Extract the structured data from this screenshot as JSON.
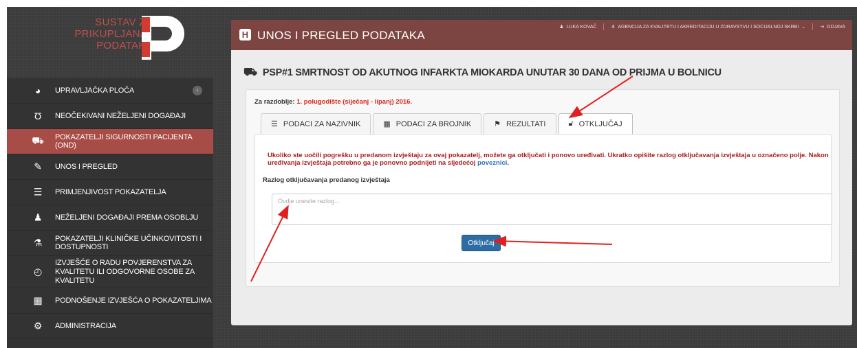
{
  "logo": {
    "line1": "SUSTAV ZA",
    "line2": "PRIKUPLJANJE",
    "line3": "PODATAKA"
  },
  "sidebar": {
    "items": [
      {
        "label": "UPRAVLJAČKA PLOČA",
        "icon": "dashboard-icon"
      },
      {
        "label": "NEOČEKIVANI NEŽELJENI DOGAĐAJI",
        "icon": "stethoscope-icon"
      },
      {
        "label": "POKAZATELJI SIGURNOSTI PACIJENTA (OND)",
        "icon": "ambulance-icon",
        "active": true
      },
      {
        "label": "UNOS I PREGLED",
        "icon": "edit-icon"
      },
      {
        "label": "PRIMJENJIVOST POKAZATELJA",
        "icon": "list-icon"
      },
      {
        "label": "NEŽELJENI DOGAĐAJI PREMA OSOBLJU",
        "icon": "user-md-icon"
      },
      {
        "label": "POKAZATELJI KLINIČKE UČINKOVITOSTI I DOSTUPNOSTI",
        "icon": "flask-icon"
      },
      {
        "label": "IZVJEŠĆE O RADU POVJERENSTVA ZA KVALITETU ILI ODGOVORNE OSOBE ZA KVALITETU",
        "icon": "clock-icon"
      },
      {
        "label": "PODNOŠENJE IZVJEŠĆA O POKAZATELJIMA",
        "icon": "table-icon"
      },
      {
        "label": "ADMINISTRACIJA",
        "icon": "gears-icon"
      }
    ]
  },
  "header": {
    "title": "UNOS I PREGLED PODATAKA",
    "user": "LUKA KOVAČ",
    "agency": "AGENCIJA ZA KVALITETU I AKREDITACIJU U ZDRAVSTVU I SOCIJALNOJ SKRBI",
    "logout": "ODJAVA"
  },
  "page": {
    "heading": "PSP#1 SMRTNOST OD AKUTNOG INFARKTA MIOKARDA UNUTAR 30 DANA OD PRIJMA U BOLNICU",
    "period_label": "Za razdoblje:",
    "period_value": "1. polugodište (siječanj - lipanj) 2016."
  },
  "tabs": [
    {
      "label": "PODACI ZA NAZIVNIK",
      "icon": "list-icon"
    },
    {
      "label": "PODACI ZA BROJNIK",
      "icon": "table-icon"
    },
    {
      "label": "REZULTATI",
      "icon": "flag-icon"
    },
    {
      "label": "OTKLJUČAJ",
      "icon": "unlock-icon",
      "active": true
    }
  ],
  "unlock": {
    "warning": "Ukoliko ste uočili pogrešku u predanom izvještaju za ovaj pokazatelj, možete ga otključati i ponovo uređivati. Ukratko opišite razlog otključavanja izvještaja u označeno polje. Nakon uređivanja izvještaja potrebno ga je ponovno podnijeti na sljedećoj",
    "link": "poveznici",
    "reason_label": "Razlog otključavanja predanog izvještaja",
    "placeholder": "Ovdje unesite razlog...",
    "button": "Otključaj"
  },
  "colors": {
    "accent": "#a84c47",
    "header": "#7d4541",
    "button": "#2e6da4",
    "arrow": "#e02020"
  }
}
